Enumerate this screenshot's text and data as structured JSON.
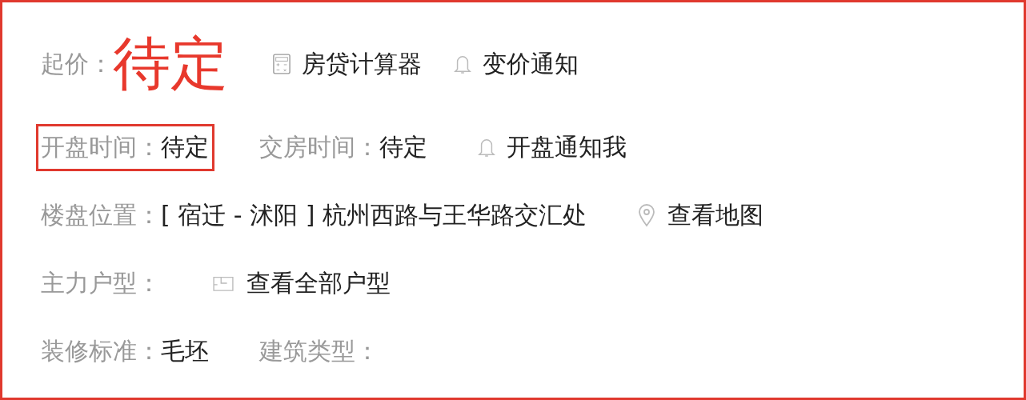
{
  "price": {
    "label": "起价：",
    "value": "待定"
  },
  "rows": [
    {
      "items": [
        {
          "kind": "calculator",
          "text": "房贷计算器"
        },
        {
          "kind": "bell",
          "text": "变价通知"
        }
      ]
    },
    {
      "items": [
        {
          "kind": "field",
          "label": "开盘时间：",
          "value": "待定",
          "highlighted": true
        },
        {
          "kind": "field",
          "label": "交房时间：",
          "value": "待定",
          "highlighted": false
        },
        {
          "kind": "bell",
          "text": "开盘通知我"
        }
      ]
    },
    {
      "items": [
        {
          "kind": "field",
          "label": "楼盘位置：",
          "value": "[ 宿迁 - 沭阳 ] 杭州西路与王华路交汇处",
          "highlighted": false
        },
        {
          "kind": "pin",
          "text": "查看地图"
        }
      ]
    },
    {
      "items": [
        {
          "kind": "field",
          "label": "主力户型：",
          "highlighted": false
        },
        {
          "kind": "floorplan",
          "text": "查看全部户型"
        }
      ]
    },
    {
      "items": [
        {
          "kind": "field",
          "label": "装修标准：",
          "value": "毛坯",
          "highlighted": false
        },
        {
          "kind": "field",
          "label": "建筑类型：",
          "highlighted": false
        }
      ]
    }
  ]
}
